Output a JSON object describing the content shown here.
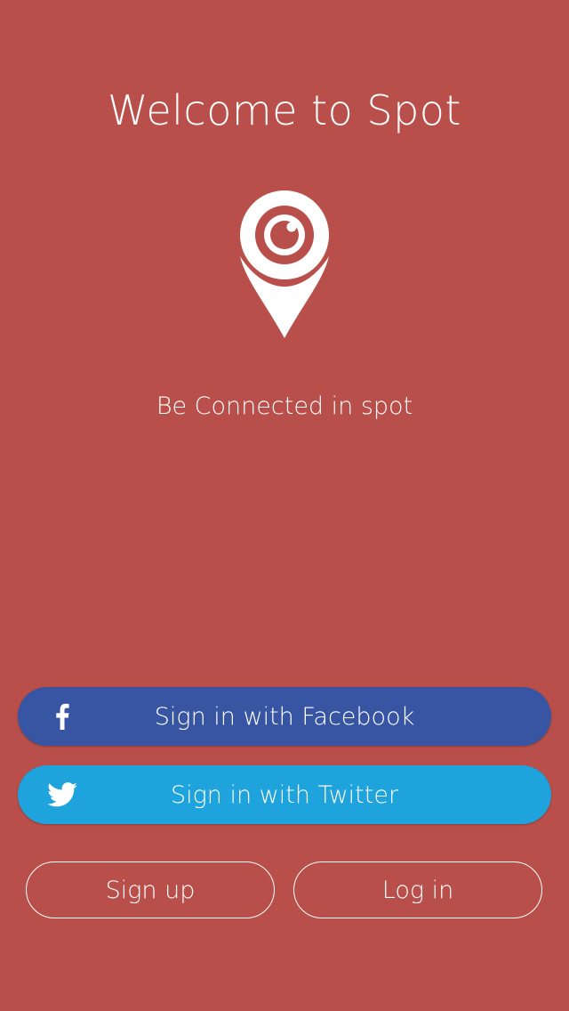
{
  "app": {
    "title": "Welcome to Spot",
    "tagline": "Be Connected in spot",
    "logo_icon": "location-pin-eye-icon"
  },
  "colors": {
    "background": "#b94f4a",
    "facebook": "#3855a3",
    "twitter": "#1fa3dc",
    "text": "#ffffff"
  },
  "buttons": {
    "facebook": {
      "label": "Sign in with Facebook",
      "icon": "facebook-icon"
    },
    "twitter": {
      "label": "Sign in with Twitter",
      "icon": "twitter-icon"
    },
    "signup": {
      "label": "Sign up"
    },
    "login": {
      "label": "Log in"
    }
  }
}
